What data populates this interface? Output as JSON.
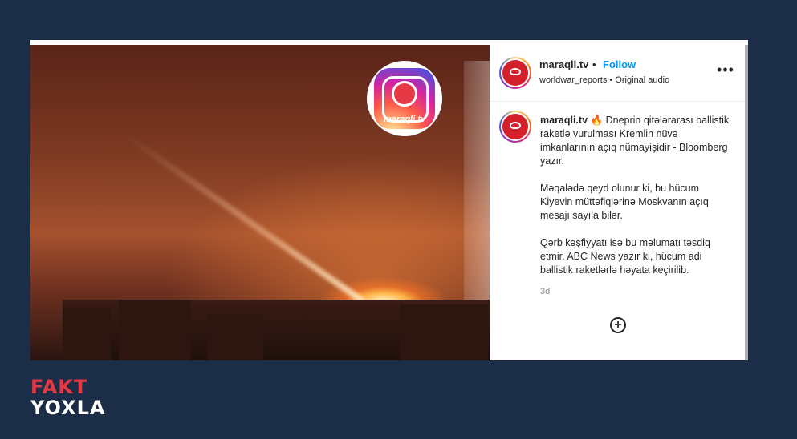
{
  "post": {
    "username": "maraqli.tv",
    "separator": "•",
    "follow_label": "Follow",
    "subline": "worldwar_reports • Original audio",
    "more_label": "•••"
  },
  "video": {
    "watermark_text": "maraqli tv"
  },
  "caption": {
    "username": "maraqli.tv",
    "emoji": "🔥",
    "paragraphs": [
      " Dneprin qitələrarası ballistik raketlə vurulması Kremlin nüvə imkanlarının açıq nümayişidir - Bloomberg yazır.",
      "Məqalədə qeyd olunur ki, bu hücum Kiyevin müttəfiqlərinə Moskvanın açıq mesajı sayıla bilər.",
      "Qərb kəşfiyyatı isə bu məlumatı təsdiq etmir. ABC News yazır ki, hücum adi ballistik raketlərlə həyata keçirilib."
    ],
    "age": "3d"
  },
  "actions": {
    "add_glyph": "+"
  },
  "brand": {
    "line1": "FAKT",
    "line2": "YOXLA"
  }
}
